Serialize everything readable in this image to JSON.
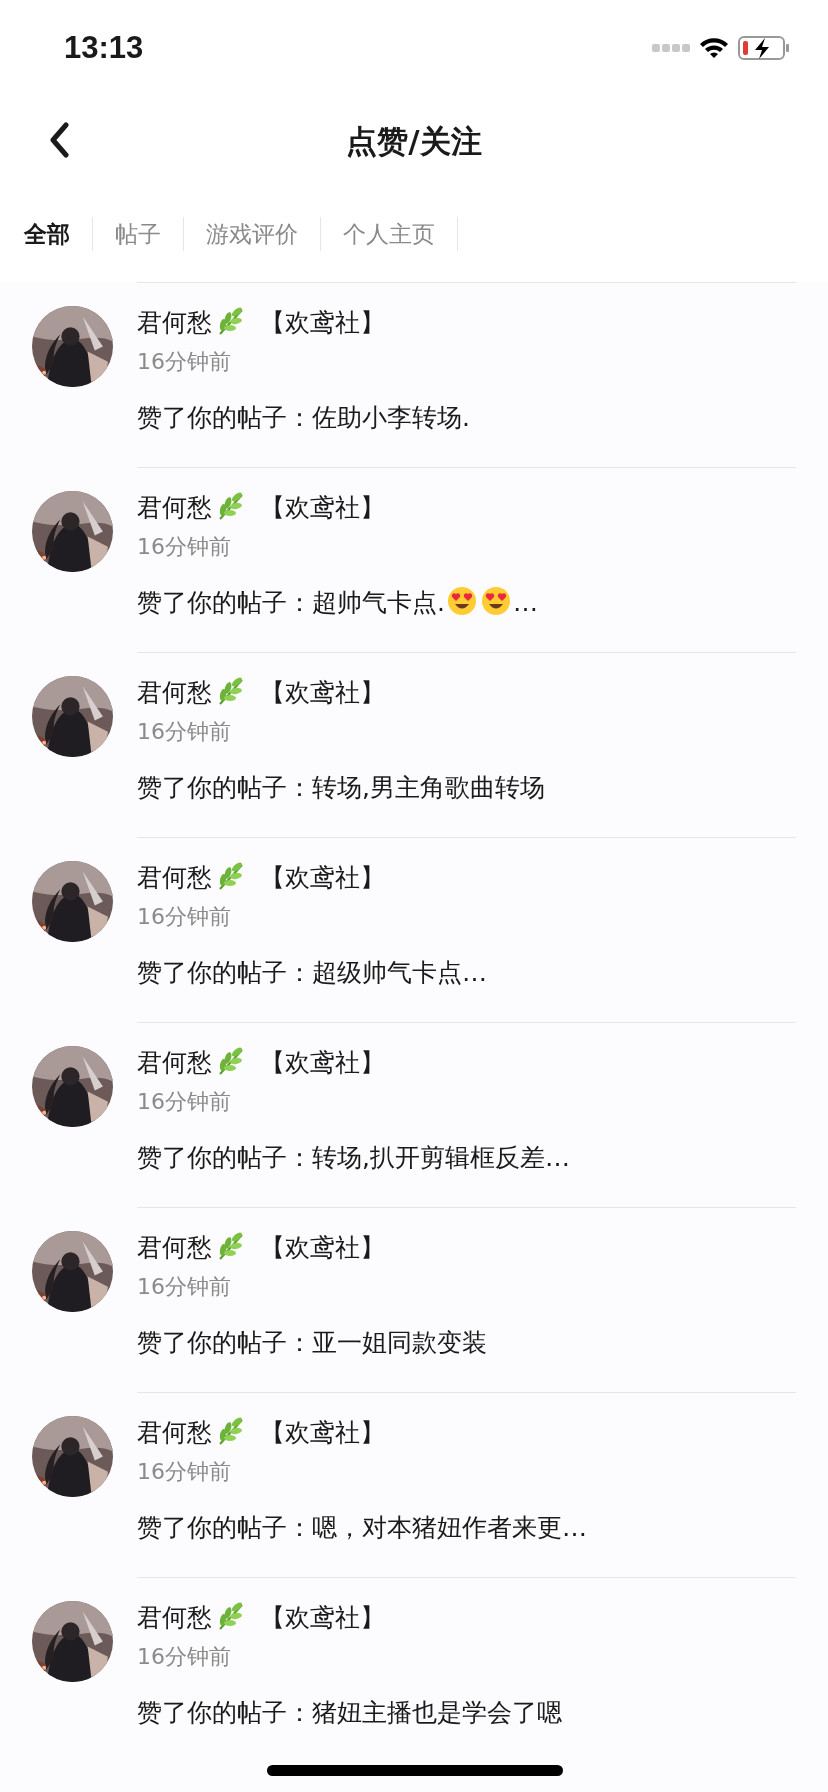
{
  "status_bar": {
    "time": "13:13"
  },
  "header": {
    "title": "点赞/关注"
  },
  "tabs": [
    {
      "label": "全部",
      "selected": true
    },
    {
      "label": "帖子",
      "selected": false
    },
    {
      "label": "游戏评价",
      "selected": false
    },
    {
      "label": "个人主页",
      "selected": false
    }
  ],
  "notifications": [
    {
      "name": "君何愁",
      "group": "【欢鸢社】",
      "time": "16分钟前",
      "message_parts": [
        {
          "kind": "text",
          "text": "赞了你的帖子：佐助小李转场."
        }
      ]
    },
    {
      "name": "君何愁",
      "group": "【欢鸢社】",
      "time": "16分钟前",
      "message_parts": [
        {
          "kind": "text",
          "text": "赞了你的帖子：超帅气卡点."
        },
        {
          "kind": "emoji"
        },
        {
          "kind": "emoji"
        },
        {
          "kind": "text",
          "text": "…"
        }
      ]
    },
    {
      "name": "君何愁",
      "group": "【欢鸢社】",
      "time": "16分钟前",
      "message_parts": [
        {
          "kind": "text",
          "text": "赞了你的帖子：转场,男主角歌曲转场"
        }
      ]
    },
    {
      "name": "君何愁",
      "group": "【欢鸢社】",
      "time": "16分钟前",
      "message_parts": [
        {
          "kind": "text",
          "text": "赞了你的帖子：超级帅气卡点…"
        }
      ]
    },
    {
      "name": "君何愁",
      "group": "【欢鸢社】",
      "time": "16分钟前",
      "message_parts": [
        {
          "kind": "text",
          "text": "赞了你的帖子：转场,扒开剪辑框反差…"
        }
      ]
    },
    {
      "name": "君何愁",
      "group": "【欢鸢社】",
      "time": "16分钟前",
      "message_parts": [
        {
          "kind": "text",
          "text": "赞了你的帖子：亚一姐同款变装"
        }
      ]
    },
    {
      "name": "君何愁",
      "group": "【欢鸢社】",
      "time": "16分钟前",
      "message_parts": [
        {
          "kind": "text",
          "text": "赞了你的帖子：嗯，对本猪妞作者来更…"
        }
      ]
    },
    {
      "name": "君何愁",
      "group": "【欢鸢社】",
      "time": "16分钟前",
      "message_parts": [
        {
          "kind": "text",
          "text": "赞了你的帖子：猪妞主播也是学会了嗯"
        }
      ]
    }
  ]
}
